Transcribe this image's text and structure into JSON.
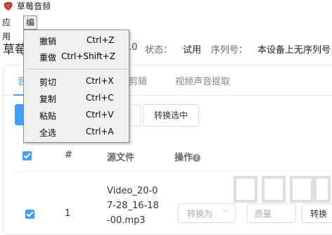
{
  "window": {
    "title": "草莓音频"
  },
  "menubar": {
    "app": "应用",
    "edit": "编辑"
  },
  "info": {
    "product_name": "草莓",
    "version_suffix": ".0",
    "status_label": "状态：",
    "status_value": "试用",
    "serial_label": "序列号：",
    "serial_value": "本设备上无序列号"
  },
  "tabs": [
    {
      "label": "音"
    },
    {
      "label": "剪辑"
    },
    {
      "label": "视频声音提取"
    }
  ],
  "toolbar": {
    "convert_selected": "转换选中"
  },
  "table": {
    "headers": {
      "num": "#",
      "source": "源文件",
      "action": "操作"
    },
    "rows": [
      {
        "num": "1",
        "filename": "Video_20-07-28_16-18-00.mp3",
        "convert_to_placeholder": "转换为",
        "quality_placeholder": "质量",
        "convert_button": "转换"
      }
    ]
  },
  "edit_menu": {
    "items": [
      {
        "label": "撤销",
        "shortcut": "Ctrl+Z"
      },
      {
        "label": "重做",
        "shortcut": "Ctrl+Shift+Z"
      },
      {
        "label": "剪切",
        "shortcut": "Ctrl+X"
      },
      {
        "label": "复制",
        "shortcut": "Ctrl+C"
      },
      {
        "label": "粘贴",
        "shortcut": "Ctrl+V"
      },
      {
        "label": "全选",
        "shortcut": "Ctrl+A"
      }
    ]
  },
  "colors": {
    "accent": "#409eff",
    "menu_bg": "#f0f0f0"
  }
}
